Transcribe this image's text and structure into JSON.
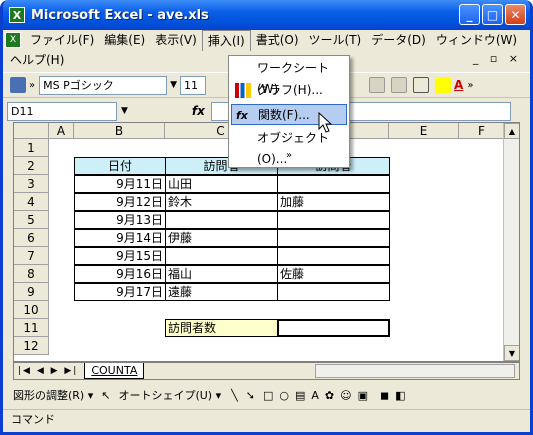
{
  "window": {
    "title": "Microsoft Excel - ave.xls",
    "app_icon": "X"
  },
  "menu": {
    "items": [
      "ファイル(F)",
      "編集(E)",
      "表示(V)",
      "挿入(I)",
      "書式(O)",
      "ツール(T)",
      "データ(D)",
      "ウィンドウ(W)"
    ],
    "help": "ヘルプ(H)",
    "doc_controls": "_ ▫ ×"
  },
  "toolbar": {
    "font_name": "MS Pゴシック",
    "font_size": "11",
    "colors": {
      "highlight": "#ffff00",
      "font": "#ff0000"
    }
  },
  "formula_bar": {
    "name_box": "D11",
    "fx": "fx"
  },
  "insert_menu": {
    "items": [
      "ワークシート(W)",
      "グラフ(H)...",
      "関数(F)...",
      "オブジェクト(O)..."
    ],
    "expand": "»"
  },
  "sheet": {
    "columns": [
      "A",
      "B",
      "C",
      "D",
      "E",
      "F"
    ],
    "rows": [
      "1",
      "2",
      "3",
      "4",
      "5",
      "6",
      "7",
      "8",
      "9",
      "10",
      "11",
      "12"
    ],
    "table_header": [
      "日付",
      "訪問者",
      "訪問者"
    ],
    "table_rows": [
      [
        "9月11日",
        "山田",
        ""
      ],
      [
        "9月12日",
        "鈴木",
        "加藤"
      ],
      [
        "9月13日",
        "",
        ""
      ],
      [
        "9月14日",
        "伊藤",
        ""
      ],
      [
        "9月15日",
        "",
        ""
      ],
      [
        "9月16日",
        "福山",
        "佐藤"
      ],
      [
        "9月17日",
        "遠藤",
        ""
      ]
    ],
    "count_label": "訪問者数",
    "count_value": ""
  },
  "tabs": {
    "nav": "|◀ ◀ ▶ ▶|",
    "sheet_name": "COUNTA"
  },
  "drawing_toolbar": {
    "draw_adjust": "図形の調整(R) ▾",
    "autoshape": "オートシェイプ(U) ▾"
  },
  "status": {
    "text": "コマンド"
  }
}
